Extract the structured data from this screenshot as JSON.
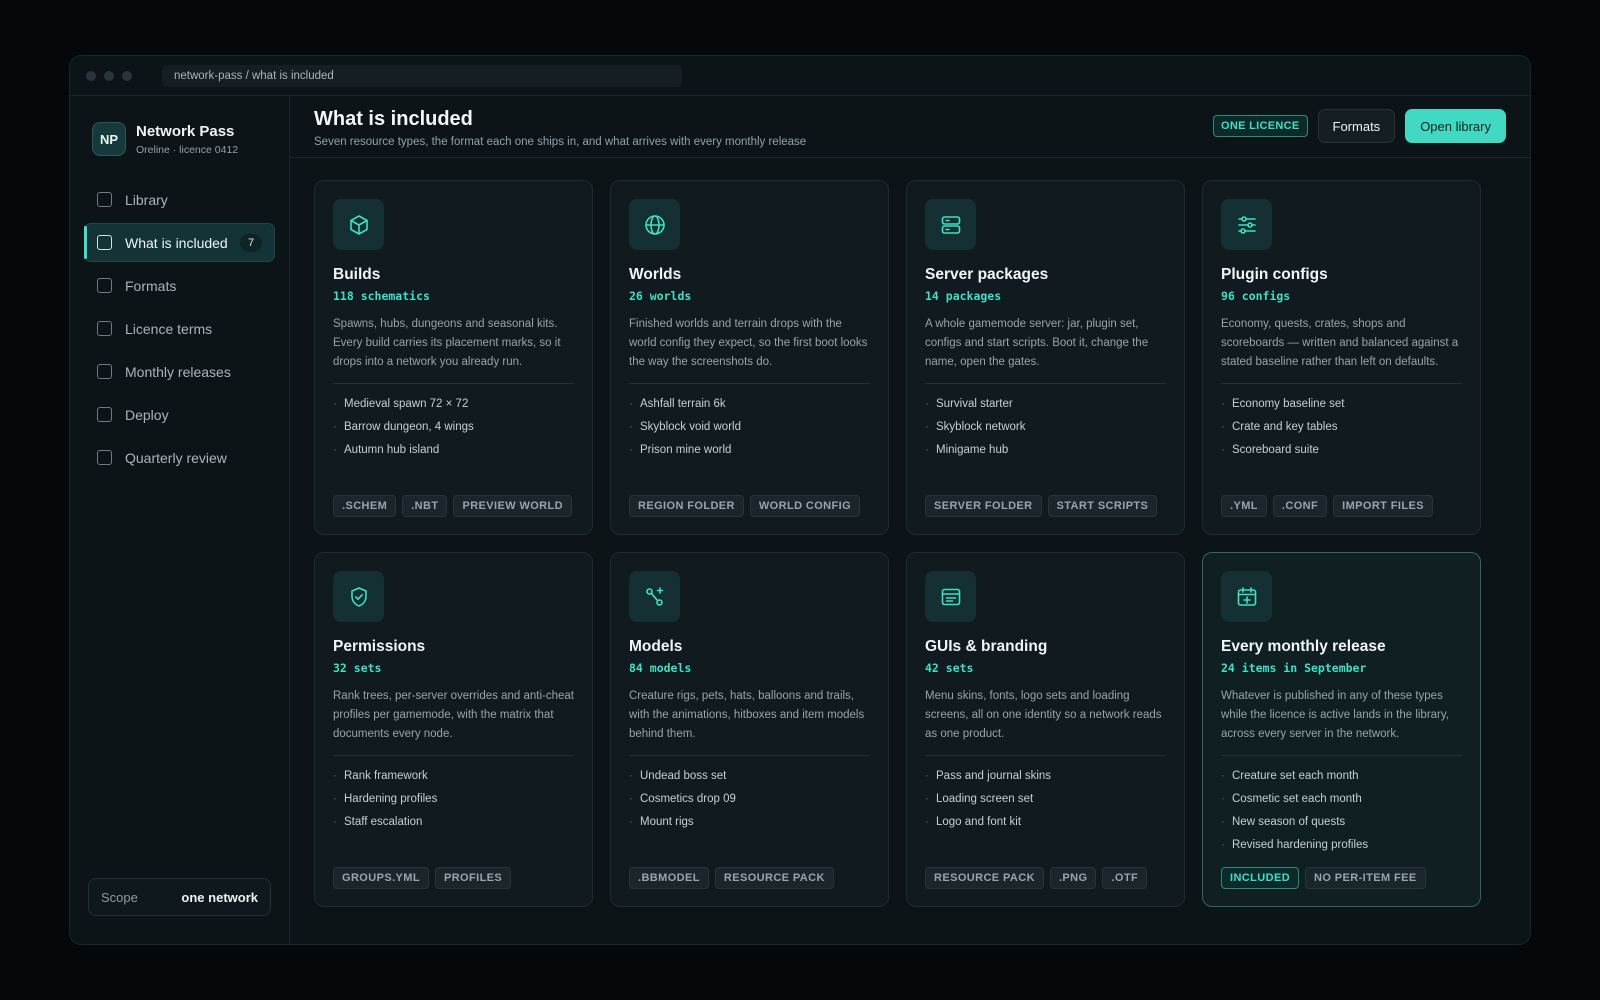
{
  "window": {
    "address": "network-pass / what is included"
  },
  "brand": {
    "initials": "NP",
    "name": "Network Pass",
    "sub": "Oreline · licence 0412"
  },
  "nav": [
    {
      "label": "Library"
    },
    {
      "label": "What is included",
      "count": "7",
      "active": true
    },
    {
      "label": "Formats"
    },
    {
      "label": "Licence terms"
    },
    {
      "label": "Monthly releases"
    },
    {
      "label": "Deploy"
    },
    {
      "label": "Quarterly review"
    }
  ],
  "scope": {
    "label": "Scope",
    "value": "one network"
  },
  "header": {
    "title": "What is included",
    "subtitle": "Seven resource types, the format each one ships in, and what arrives with every monthly release",
    "badge": "ONE LICENCE",
    "formats_label": "Formats",
    "open_label": "Open library"
  },
  "colors": {
    "accent": "#3fe0c5",
    "button": "#41d9c1",
    "background": "#05080b",
    "panel": "#0c1418"
  },
  "cards": [
    {
      "icon": "cube-icon",
      "title": "Builds",
      "count": "118 schematics",
      "desc": "Spawns, hubs, dungeons and seasonal kits. Every build carries its placement marks, so it drops into a network you already run.",
      "items": [
        "Medieval spawn 72 × 72",
        "Barrow dungeon, 4 wings",
        "Autumn hub island"
      ],
      "tags": [
        {
          "label": ".SCHEM"
        },
        {
          "label": ".NBT"
        },
        {
          "label": "PREVIEW WORLD"
        }
      ]
    },
    {
      "icon": "globe-icon",
      "title": "Worlds",
      "count": "26 worlds",
      "desc": "Finished worlds and terrain drops with the world config they expect, so the first boot looks the way the screenshots do.",
      "items": [
        "Ashfall terrain 6k",
        "Skyblock void world",
        "Prison mine world"
      ],
      "tags": [
        {
          "label": "REGION FOLDER"
        },
        {
          "label": "WORLD CONFIG"
        }
      ]
    },
    {
      "icon": "server-icon",
      "title": "Server packages",
      "count": "14 packages",
      "desc": "A whole gamemode server: jar, plugin set, configs and start scripts. Boot it, change the name, open the gates.",
      "items": [
        "Survival starter",
        "Skyblock network",
        "Minigame hub"
      ],
      "tags": [
        {
          "label": "SERVER FOLDER"
        },
        {
          "label": "START SCRIPTS"
        }
      ]
    },
    {
      "icon": "sliders-icon",
      "title": "Plugin configs",
      "count": "96 configs",
      "desc": "Economy, quests, crates, shops and scoreboards — written and balanced against a stated baseline rather than left on defaults.",
      "items": [
        "Economy baseline set",
        "Crate and key tables",
        "Scoreboard suite"
      ],
      "tags": [
        {
          "label": ".YML"
        },
        {
          "label": ".CONF"
        },
        {
          "label": "IMPORT FILES"
        }
      ]
    },
    {
      "icon": "shield-check-icon",
      "title": "Permissions",
      "count": "32 sets",
      "desc": "Rank trees, per-server overrides and anti-cheat profiles per gamemode, with the matrix that documents every node.",
      "items": [
        "Rank framework",
        "Hardening profiles",
        "Staff escalation"
      ],
      "tags": [
        {
          "label": "GROUPS.YML"
        },
        {
          "label": "PROFILES"
        }
      ]
    },
    {
      "icon": "model-nodes-icon",
      "title": "Models",
      "count": "84 models",
      "desc": "Creature rigs, pets, hats, balloons and trails, with the animations, hitboxes and item models behind them.",
      "items": [
        "Undead boss set",
        "Cosmetics drop 09",
        "Mount rigs"
      ],
      "tags": [
        {
          "label": ".BBMODEL"
        },
        {
          "label": "RESOURCE PACK"
        }
      ]
    },
    {
      "icon": "window-icon",
      "title": "GUIs & branding",
      "count": "42 sets",
      "desc": "Menu skins, fonts, logo sets and loading screens, all on one identity so a network reads as one product.",
      "items": [
        "Pass and journal skins",
        "Loading screen set",
        "Logo and font kit"
      ],
      "tags": [
        {
          "label": "RESOURCE PACK"
        },
        {
          "label": ".PNG"
        },
        {
          "label": ".OTF"
        }
      ]
    },
    {
      "icon": "calendar-plus-icon",
      "title": "Every monthly release",
      "count": "24 items in September",
      "desc": "Whatever is published in any of these types while the licence is active lands in the library, across every server in the network.",
      "items": [
        "Creature set each month",
        "Cosmetic set each month",
        "New season of quests",
        "Revised hardening profiles"
      ],
      "tags": [
        {
          "label": "INCLUDED",
          "accent": true
        },
        {
          "label": "NO PER-ITEM FEE"
        }
      ],
      "highlight": true
    }
  ]
}
